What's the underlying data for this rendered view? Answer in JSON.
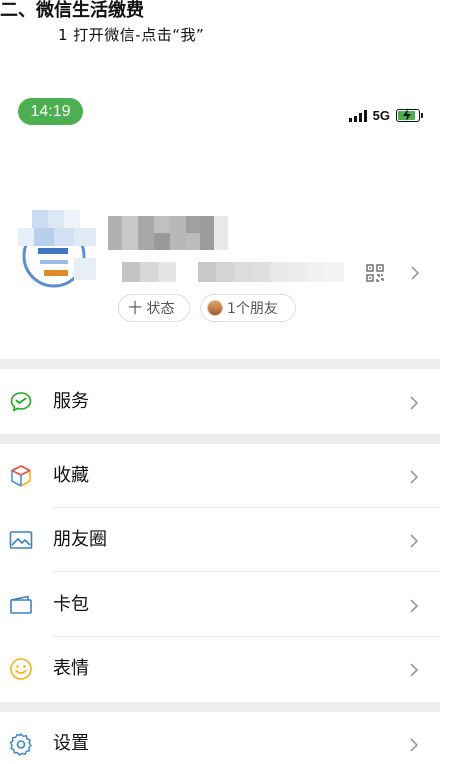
{
  "document": {
    "heading": "二、微信生活缴费",
    "step": "1 打开微信-点击“我”"
  },
  "status_bar": {
    "time": "14:19",
    "network": "5G",
    "time_badge_color": "#4caf50"
  },
  "profile": {
    "status_chip_label": "十 状态",
    "friends_chip_label": "1个朋友"
  },
  "menu": [
    {
      "label": "服务",
      "icon": "wechat-pay-icon"
    },
    {
      "label": "收藏",
      "icon": "cube-icon"
    },
    {
      "label": "朋友圈",
      "icon": "image-icon"
    },
    {
      "label": "卡包",
      "icon": "wallet-icon"
    },
    {
      "label": "表情",
      "icon": "smiley-icon"
    },
    {
      "label": "设置",
      "icon": "gear-icon"
    }
  ]
}
